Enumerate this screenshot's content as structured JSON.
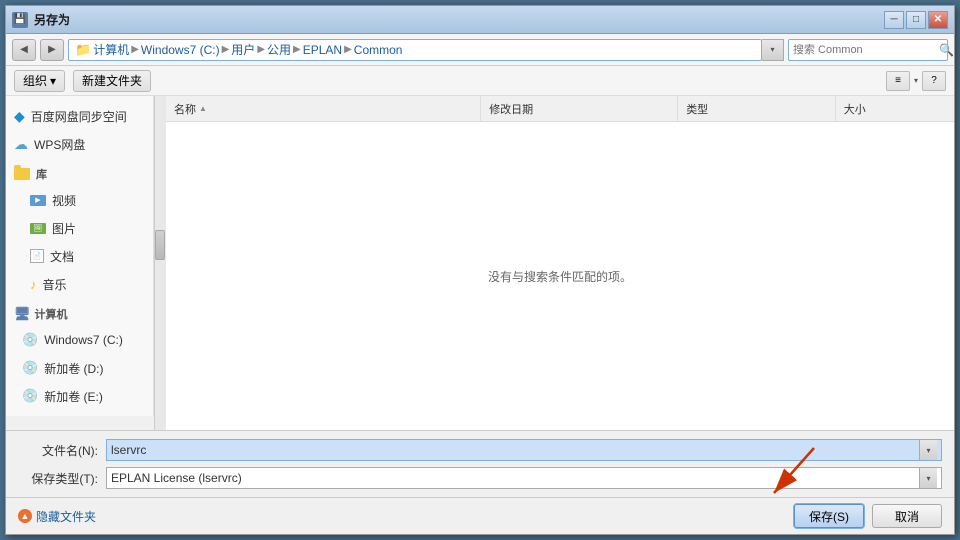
{
  "dialog": {
    "title": "另存为",
    "close_btn": "✕",
    "min_btn": "─",
    "max_btn": "□"
  },
  "address_bar": {
    "breadcrumbs": [
      "计算机",
      "Windows7 (C:)",
      "用户",
      "公用",
      "EPLAN",
      "Common"
    ],
    "search_placeholder": "搜索 Common"
  },
  "toolbar": {
    "organize_label": "组织",
    "organize_arrow": "▾",
    "new_folder_label": "新建文件夹",
    "view_icon": "≡",
    "help_icon": "?"
  },
  "sidebar": {
    "items": [
      {
        "id": "baidu",
        "label": "百度网盘同步空间",
        "icon": "cloud-blue"
      },
      {
        "id": "wps",
        "label": "WPS网盘",
        "icon": "cloud-wps"
      },
      {
        "id": "library",
        "label": "库",
        "icon": "folder"
      },
      {
        "id": "videos",
        "label": "视频",
        "icon": "video"
      },
      {
        "id": "images",
        "label": "图片",
        "icon": "image"
      },
      {
        "id": "docs",
        "label": "文档",
        "icon": "document"
      },
      {
        "id": "music",
        "label": "音乐",
        "icon": "music"
      },
      {
        "id": "computer",
        "label": "计算机",
        "icon": "computer"
      },
      {
        "id": "win7c",
        "label": "Windows7 (C:)",
        "icon": "drive"
      },
      {
        "id": "newD",
        "label": "新加卷 (D:)",
        "icon": "drive"
      },
      {
        "id": "newE",
        "label": "新加卷 (E:)",
        "icon": "drive"
      }
    ]
  },
  "file_list": {
    "columns": [
      "名称",
      "修改日期",
      "类型",
      "大小"
    ],
    "empty_message": "没有与搜索条件匹配的项。",
    "col_widths": [
      "40%",
      "25%",
      "20%",
      "15%"
    ]
  },
  "form": {
    "filename_label": "文件名(N):",
    "filename_value": "lservrc",
    "filetype_label": "保存类型(T):",
    "filetype_value": "EPLAN License (lservrc)"
  },
  "buttons": {
    "hide_folders_label": "隐藏文件夹",
    "save_label": "保存(S)",
    "cancel_label": "取消"
  }
}
